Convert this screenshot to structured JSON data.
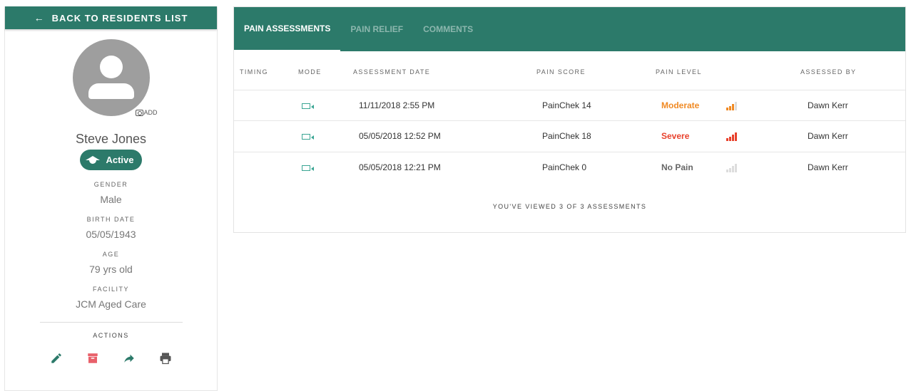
{
  "sidebar": {
    "back_label": "BACK TO RESIDENTS LIST",
    "add_photo_label": "ADD",
    "resident_name": "Steve Jones",
    "status": "Active",
    "fields": [
      {
        "label": "GENDER",
        "value": "Male"
      },
      {
        "label": "BIRTH DATE",
        "value": "05/05/1943"
      },
      {
        "label": "AGE",
        "value": "79 yrs old"
      },
      {
        "label": "FACILITY",
        "value": "JCM Aged Care"
      }
    ],
    "actions_label": "ACTIONS",
    "actions": [
      "edit-icon",
      "archive-icon",
      "share-icon",
      "print-icon"
    ]
  },
  "tabs": [
    {
      "label": "PAIN ASSESSMENTS",
      "active": true
    },
    {
      "label": "PAIN RELIEF",
      "active": false
    },
    {
      "label": "COMMENTS",
      "active": false
    }
  ],
  "table": {
    "headers": [
      "TIMING",
      "MODE",
      "ASSESSMENT DATE",
      "PAIN SCORE",
      "PAIN LEVEL",
      "",
      "ASSESSED BY"
    ],
    "rows": [
      {
        "timing": "",
        "mode": "video-icon",
        "date": "11/11/2018 2:55 PM",
        "score": "PainChek 14",
        "level": "Moderate",
        "level_color": "#f08a24",
        "bars_filled": 3,
        "assessed_by": "Dawn Kerr"
      },
      {
        "timing": "",
        "mode": "video-icon",
        "date": "05/05/2018 12:52 PM",
        "score": "PainChek 18",
        "level": "Severe",
        "level_color": "#e8412c",
        "bars_filled": 4,
        "assessed_by": "Dawn Kerr"
      },
      {
        "timing": "",
        "mode": "video-icon",
        "date": "05/05/2018 12:21 PM",
        "score": "PainChek 0",
        "level": "No Pain",
        "level_color": "#666666",
        "bars_filled": 0,
        "assessed_by": "Dawn Kerr"
      }
    ],
    "footer": "YOU'VE VIEWED 3 OF 3 ASSESSMENTS"
  },
  "colors": {
    "brand": "#2c7a6a",
    "archive": "#e8606a",
    "bar_empty": "#dddddd"
  }
}
